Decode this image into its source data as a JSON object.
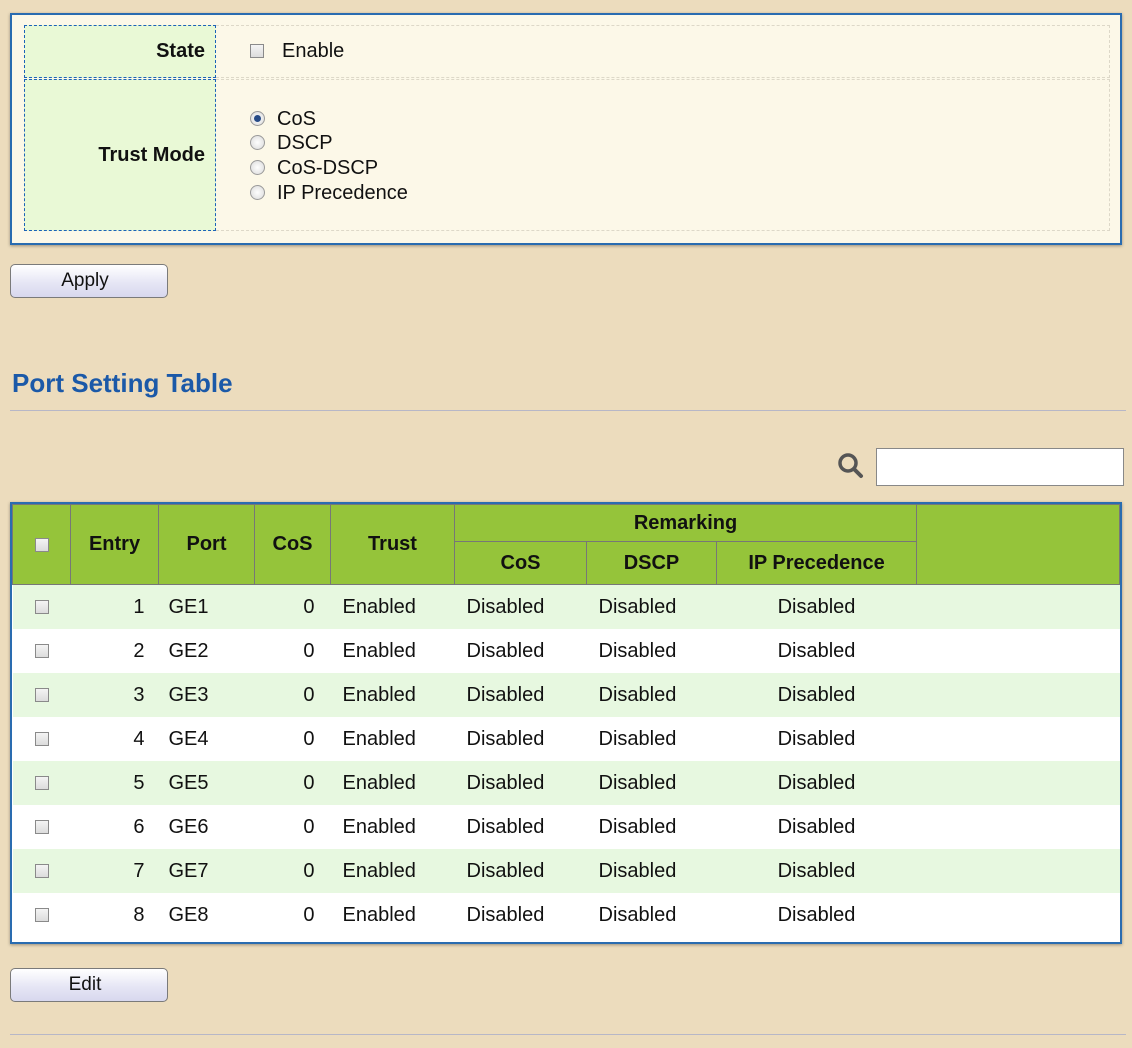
{
  "settings": {
    "state_label": "State",
    "state_enable_label": "Enable",
    "state_enabled": false,
    "trust_mode_label": "Trust Mode",
    "trust_options": [
      "CoS",
      "DSCP",
      "CoS-DSCP",
      "IP Precedence"
    ],
    "trust_selected": "CoS"
  },
  "buttons": {
    "apply": "Apply",
    "edit": "Edit"
  },
  "port_table": {
    "title": "Port Setting Table",
    "search_value": "",
    "headers": {
      "entry": "Entry",
      "port": "Port",
      "cos": "CoS",
      "trust": "Trust",
      "remarking": "Remarking",
      "remark_cos": "CoS",
      "remark_dscp": "DSCP",
      "remark_ip": "IP Precedence"
    },
    "rows": [
      {
        "entry": "1",
        "port": "GE1",
        "cos": "0",
        "trust": "Enabled",
        "remark_cos": "Disabled",
        "remark_dscp": "Disabled",
        "remark_ip": "Disabled"
      },
      {
        "entry": "2",
        "port": "GE2",
        "cos": "0",
        "trust": "Enabled",
        "remark_cos": "Disabled",
        "remark_dscp": "Disabled",
        "remark_ip": "Disabled"
      },
      {
        "entry": "3",
        "port": "GE3",
        "cos": "0",
        "trust": "Enabled",
        "remark_cos": "Disabled",
        "remark_dscp": "Disabled",
        "remark_ip": "Disabled"
      },
      {
        "entry": "4",
        "port": "GE4",
        "cos": "0",
        "trust": "Enabled",
        "remark_cos": "Disabled",
        "remark_dscp": "Disabled",
        "remark_ip": "Disabled"
      },
      {
        "entry": "5",
        "port": "GE5",
        "cos": "0",
        "trust": "Enabled",
        "remark_cos": "Disabled",
        "remark_dscp": "Disabled",
        "remark_ip": "Disabled"
      },
      {
        "entry": "6",
        "port": "GE6",
        "cos": "0",
        "trust": "Enabled",
        "remark_cos": "Disabled",
        "remark_dscp": "Disabled",
        "remark_ip": "Disabled"
      },
      {
        "entry": "7",
        "port": "GE7",
        "cos": "0",
        "trust": "Enabled",
        "remark_cos": "Disabled",
        "remark_dscp": "Disabled",
        "remark_ip": "Disabled"
      },
      {
        "entry": "8",
        "port": "GE8",
        "cos": "0",
        "trust": "Enabled",
        "remark_cos": "Disabled",
        "remark_dscp": "Disabled",
        "remark_ip": "Disabled"
      }
    ]
  },
  "colors": {
    "page_bg": "#ecdcbd",
    "panel_border": "#2a6cb0",
    "header_green": "#95c43a",
    "row_alt": "#e7f8e0",
    "title_blue": "#1b59a8"
  },
  "icons": {
    "search": "search-icon"
  }
}
